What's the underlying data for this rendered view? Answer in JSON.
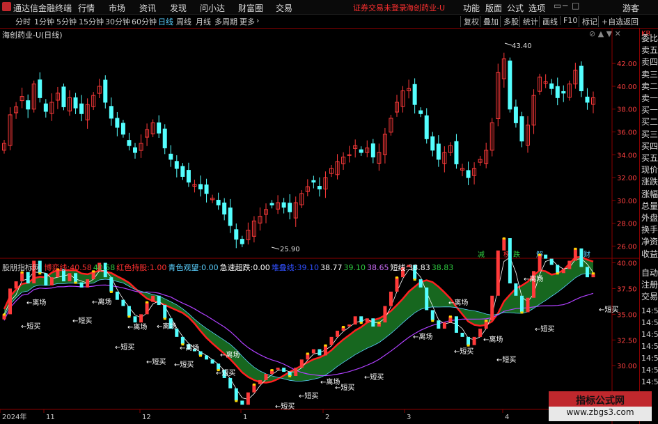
{
  "topbar": {
    "app_name": "通达信金融终端",
    "menu": [
      "行情",
      "市场",
      "资讯",
      "发现",
      "问小达",
      "财富圈",
      "交易"
    ],
    "notice": "证券交易未登录",
    "stock_title": "海创药业-U",
    "right_menu": [
      "功能",
      "版面",
      "公式",
      "选项"
    ],
    "user": "游客",
    "window_controls": [
      "▭",
      "─",
      "□",
      "✕"
    ]
  },
  "periods": {
    "items": [
      "分时",
      "1分钟",
      "5分钟",
      "15分钟",
      "30分钟",
      "60分钟",
      "日线",
      "周线",
      "月线",
      "多周期",
      "更多"
    ],
    "active": "日线",
    "more_glyph": "›"
  },
  "toolbar": [
    "复权",
    "叠加",
    "多股",
    "统计",
    "画线",
    "F10",
    "标记",
    "+自选",
    "返回"
  ],
  "stock_label": "海创药业-U(日线)",
  "chart_controls": [
    "⊘",
    "▲",
    "▼",
    "✕"
  ],
  "right_panel": {
    "badge": "KR",
    "items": [
      "委比",
      "卖五",
      "卖四",
      "卖三",
      "卖二",
      "卖一",
      "买一",
      "买二",
      "买三",
      "买四",
      "买五",
      "现价",
      "涨跌",
      "涨幅",
      "总量",
      "外盘",
      "换手",
      "净资",
      "收益"
    ],
    "lower_items": [
      "自动",
      "注册",
      "交易"
    ],
    "times": [
      "14:5",
      "14:5",
      "14:5",
      "14:5",
      "14:5",
      "14:5",
      "14:5"
    ]
  },
  "main_axis": [
    "42.00",
    "40.00",
    "38.00",
    "36.00",
    "34.00",
    "32.00",
    "30.00",
    "28.00",
    "26.00"
  ],
  "annotations": {
    "high": "43.40",
    "low": "25.90"
  },
  "event_tags": [
    {
      "text": "减",
      "color": "#2ecc40"
    },
    {
      "text": "榜",
      "color": "#ff3030"
    },
    {
      "text": "跌",
      "color": "#2ecc40"
    },
    {
      "text": "解",
      "color": "#5ad0ff"
    },
    {
      "text": "财",
      "color": "#5ad0ff"
    }
  ],
  "indicator": {
    "name": "股朋指标网",
    "items": [
      {
        "label": "博弈线:",
        "value": "40.58",
        "color": "#ff3030"
      },
      {
        "label": "",
        "value": "40.58",
        "color": "#2ecc40"
      },
      {
        "label": "红色持股:",
        "value": "1.00",
        "color": "#ff3030"
      },
      {
        "label": "青色观望:",
        "value": "0.00",
        "color": "#5ad0ff"
      },
      {
        "label": "急速超跌:",
        "value": "0.00",
        "color": "#ffffff"
      },
      {
        "label": "堆叠线:",
        "value": "39.10",
        "color": "#3050ff"
      },
      {
        "label": "",
        "value": "38.77",
        "color": "#ffffff"
      },
      {
        "label": "",
        "value": "39.10",
        "color": "#2ecc40"
      },
      {
        "label": "",
        "value": "38.65",
        "color": "#d070ff"
      },
      {
        "label": "短线:",
        "value": "38.83",
        "color": "#ffffff"
      },
      {
        "label": "",
        "value": "38.83",
        "color": "#2ecc40"
      }
    ]
  },
  "indicator_axis": [
    "40.00",
    "37.50",
    "35.00",
    "32.50",
    "30.00"
  ],
  "signal_labels": {
    "leave": "离场",
    "buy": "短买"
  },
  "date_axis": [
    "2024年",
    "11",
    "12",
    "1",
    "2",
    "3",
    "4"
  ],
  "watermark": {
    "line1": "指标公式网",
    "line2": "www.zbgs3.com"
  },
  "chart_data": {
    "type": "candlestick",
    "ylim": [
      25.5,
      44.0
    ],
    "grid": false,
    "candles_close_approx": [
      35.0,
      37.5,
      38.2,
      39.1,
      38.0,
      40.2,
      39.0,
      37.8,
      38.6,
      39.4,
      38.2,
      39.0,
      38.1,
      37.6,
      38.4,
      39.2,
      40.0,
      38.6,
      37.2,
      36.4,
      35.8,
      34.8,
      34.2,
      35.0,
      36.2,
      36.8,
      35.9,
      34.6,
      33.6,
      32.8,
      32.1,
      31.6,
      31.4,
      31.0,
      30.6,
      30.2,
      29.6,
      28.8,
      27.8,
      26.6,
      26.2,
      27.4,
      28.2,
      28.6,
      29.2,
      29.6,
      29.8,
      29.4,
      29.0,
      29.8,
      30.6,
      31.2,
      31.6,
      31.0,
      32.0,
      32.8,
      33.4,
      33.8,
      34.0,
      34.8,
      34.2,
      34.6,
      33.8,
      34.2,
      35.8,
      37.2,
      38.6,
      39.6,
      39.8,
      38.4,
      37.6,
      35.4,
      34.4,
      33.6,
      34.2,
      34.8,
      33.2,
      32.8,
      32.0,
      32.8,
      33.6,
      34.4,
      36.8,
      41.2,
      42.4,
      38.0,
      36.8,
      35.2,
      36.6,
      39.2,
      40.8,
      40.4,
      39.8,
      39.0,
      39.4,
      40.2,
      41.4,
      39.6,
      38.6,
      39.0
    ]
  }
}
